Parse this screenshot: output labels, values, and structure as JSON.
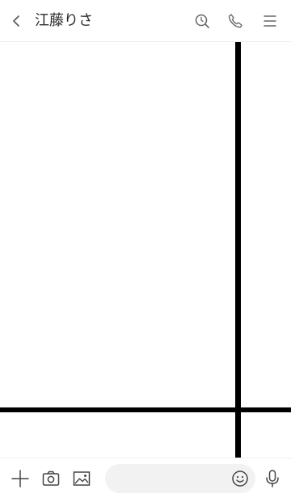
{
  "header": {
    "title": "江藤りさ",
    "icons": {
      "back": "chevron-left-icon",
      "search": "search-icon",
      "call": "phone-icon",
      "menu": "menu-icon"
    }
  },
  "chat": {
    "background": "#ffffff",
    "line_color": "#000000"
  },
  "footer": {
    "icons": {
      "add": "plus-icon",
      "camera": "camera-icon",
      "image": "image-icon",
      "emoji": "emoji-icon",
      "mic": "microphone-icon"
    },
    "message_input": {
      "value": "",
      "placeholder": ""
    }
  },
  "colors": {
    "icon": "#555555",
    "input_bg": "#f2f2f2",
    "divider": "#efefef"
  }
}
